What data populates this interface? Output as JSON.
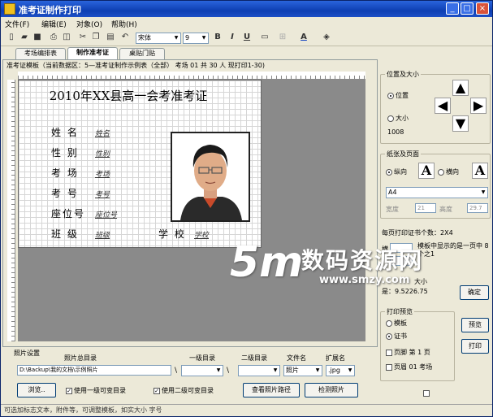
{
  "window": {
    "title": "准考证制作打印"
  },
  "menu": [
    "文件(F)",
    "编辑(E)",
    "对象(O)",
    "帮助(H)"
  ],
  "toolbar": {
    "font": "宋体",
    "size": "9",
    "bold": "B",
    "italic": "I",
    "underline": "U",
    "font_color": "A"
  },
  "tabs": [
    {
      "label": "考场编排表"
    },
    {
      "label": "制作准考证"
    },
    {
      "label": "桌贴门贴"
    }
  ],
  "info_line": "准考证模板（当前数据区：5—准考证制作示例表（全部）  考场 01 共 30 人 现打印1-30)",
  "card": {
    "title": "2010年XX县高一会考准考证",
    "rows": [
      {
        "label": "姓  名",
        "value": "姓名"
      },
      {
        "label": "性  别",
        "value": "性别"
      },
      {
        "label": "考  场",
        "value": "考场"
      },
      {
        "label": "考  号",
        "value": "考号"
      },
      {
        "label": "座位号",
        "value": "座位号"
      },
      {
        "label": "班  级",
        "value": "班级"
      }
    ],
    "school_label": "学  校",
    "school_value": "学校"
  },
  "position_group": {
    "title": "位置及大小",
    "opt_position": "位置",
    "opt_size": "大小",
    "value": "1008"
  },
  "paper_group": {
    "title": "纸张及页面",
    "portrait": "纵向",
    "landscape": "横向",
    "paper": "A4",
    "width_label": "宽度",
    "width_value": "21",
    "height_label": "高度",
    "height_value": "29.7"
  },
  "per_page": {
    "text": "每页打印证书个数：2X4",
    "template_note": "模板中显示的是一页中 8 个之1",
    "sample_label": "横",
    "ratio": "是：9.5226.75",
    "ratio_prefix": "大小",
    "confirm": "确定"
  },
  "preview_group": {
    "title": "打印预览",
    "opt_template": "模板",
    "opt_cert": "证书",
    "page_check": "页脚 第 1 页",
    "header_check": "页眉 01 考场",
    "preview_button": "预览",
    "print_button": "打印"
  },
  "photo_settings": {
    "title": "照片设置",
    "root_label": "照片总目录",
    "path": "D:\\Backup\\我的文档\\示例照片",
    "level1_label": "一级目录",
    "level2_label": "二级目录",
    "filename_label": "文件名",
    "filename_value": "照片",
    "ext_label": "扩展名",
    "ext_value": ".jpg",
    "browse": "浏览..",
    "use_level1": "使用一级可变目录",
    "use_level2": "使用二级可变目录",
    "view_path": "查看照片路径",
    "check_photos": "检测照片"
  },
  "status": "可选加标志文本，附件等，可调整模板，如实大小 字号",
  "watermark": {
    "logo": "5m",
    "text": "数码资源网",
    "url": "www.smzy.com"
  }
}
